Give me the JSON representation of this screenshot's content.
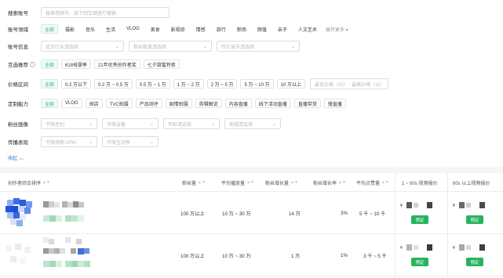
{
  "search": {
    "label": "搜索账号",
    "placeholder": "搜索视频号、按下回车键进行搜索"
  },
  "domain": {
    "label": "账号领域",
    "tags": [
      "全部",
      "摄影",
      "音乐",
      "生活",
      "VLOG",
      "美食",
      "影视综",
      "情感",
      "旅行",
      "职场",
      "颜值",
      "亲子",
      "人文艺术"
    ],
    "active_index": 0,
    "more_label": "展开更多"
  },
  "account_info": {
    "label": "账号信息",
    "selects": [
      "适合行业请选择",
      "粉丝数量请选择",
      "所在城市请选择"
    ]
  },
  "recommend": {
    "label": "互选推荐",
    "help": "?",
    "tags": [
      "全部",
      "618母婴季",
      "21年优秀创作者奖",
      "七夕甜蜜特卖"
    ],
    "active_index": 0
  },
  "price_range": {
    "label": "价格区间",
    "tags": [
      "全部",
      "0.2 万以下",
      "0.2 万 ~ 0.5 万",
      "0.5 万 ~ 1 万",
      "1 万 ~ 2 万",
      "2 万 ~ 5 万",
      "5 万 ~ 10 万",
      "10 万以上"
    ],
    "active_index": 0,
    "range_placeholder": "最低价格（元） - 最高价格（元）"
  },
  "custom": {
    "label": "定制能力",
    "tags": [
      "全部",
      "VLOG",
      "探店",
      "TVC拍摄",
      "产品测评",
      "剧情拍摄",
      "剪辑解说",
      "内容直播",
      "线下活动直播",
      "直播带货",
      "慢直播"
    ],
    "active_index": 0
  },
  "fans_profile": {
    "label": "粉丝画像",
    "selects": [
      "不限性别",
      "不限设备",
      "年龄请选择",
      "地域请选择"
    ]
  },
  "spread": {
    "label": "传播表现",
    "selects": [
      "不限预期 CPM",
      "不限互动率"
    ]
  },
  "collapse_label": "收起",
  "table": {
    "headers": {
      "creator": "创作者综合排序",
      "fans": "粉丝量",
      "avg_play": "平均播放量",
      "fans_growth": "粉丝增长量",
      "growth_rate": "粉丝增长率",
      "avg_like": "平均点赞量",
      "price_short": "1 ~ 60s 视频报价",
      "price_long": "60s 以上视频报价"
    },
    "rows": [
      {
        "fans": "100 万以上",
        "avg_play": "10 万 ~ 30 万",
        "fans_growth": "14 万",
        "growth_rate": "3%",
        "avg_like": "5 千 ~ 10 千",
        "price_prefix_1": "¥",
        "price_prefix_2": "¥",
        "book_1": "预定",
        "book_2": "预定"
      },
      {
        "fans": "100 万以上",
        "avg_play": "10 万 ~ 30 万",
        "fans_growth": "1 万",
        "growth_rate": "1%",
        "avg_like": "3 千 ~ 5 千",
        "price_prefix_1": "¥",
        "price_prefix_2": "¥",
        "book_1": "预定",
        "book_2": "预定"
      }
    ]
  },
  "colors": {
    "accent": "#2bb673",
    "button": "#27b35e",
    "link": "#2f7bd9"
  }
}
